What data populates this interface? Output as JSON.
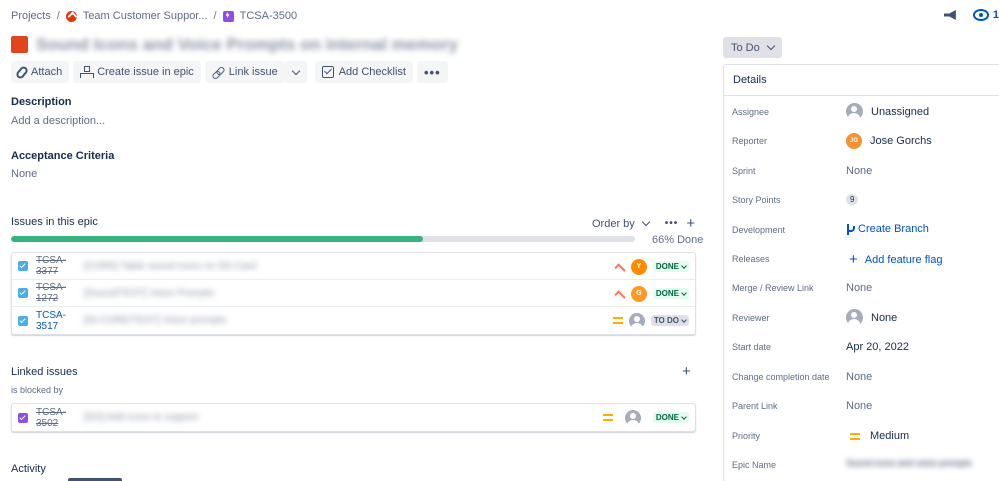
{
  "breadcrumb": {
    "projects": "Projects",
    "project": "Team Customer Suppor...",
    "epic_key": "TCSA-3500",
    "separator": "/"
  },
  "header": {
    "watch_count": "1",
    "title": "Sound Icons and Voice Prompts on internal memory"
  },
  "toolbar": {
    "attach": "Attach",
    "create_issue_in_epic": "Create issue in epic",
    "link_issue": "Link issue",
    "add_checklist": "Add Checklist",
    "more": "•••"
  },
  "description": {
    "label": "Description",
    "placeholder": "Add a description..."
  },
  "acceptance": {
    "label": "Acceptance Criteria",
    "value": "None"
  },
  "epic_issues": {
    "label": "Issues in this epic",
    "order_by": "Order by",
    "more": "•••",
    "add": "+",
    "progress_done_fraction": 0.66,
    "progress_label": "66% Done",
    "items": [
      {
        "key": "TCSA-3377",
        "summary": "[CORE] Table sound icons on SD Card",
        "priority": "high",
        "avatar": "Y",
        "status": "DONE",
        "resolved": true
      },
      {
        "key": "TCSA-1272",
        "summary": "[Sound/TEST] Voice Prompts",
        "priority": "high",
        "avatar": "G",
        "status": "DONE",
        "resolved": true
      },
      {
        "key": "TCSA-3517",
        "summary": "[NI-CORE/TEST] Voice prompts",
        "priority": "medium",
        "avatar": "",
        "status": "TO DO",
        "resolved": false
      }
    ]
  },
  "linked_issues": {
    "label": "Linked issues",
    "add": "+",
    "relation": "is blocked by",
    "items": [
      {
        "key": "TCSA-3502",
        "summary": "[DO] Add icons to support",
        "status": "DONE",
        "resolved": true
      }
    ]
  },
  "activity": {
    "label": "Activity"
  },
  "status_button": {
    "label": "To Do"
  },
  "details": {
    "heading": "Details",
    "assignee": {
      "label": "Assignee",
      "value": "Unassigned"
    },
    "reporter": {
      "label": "Reporter",
      "value": "Jose Gorchs",
      "initials": "JG"
    },
    "sprint": {
      "label": "Sprint",
      "value": "None"
    },
    "story_points": {
      "label": "Story Points",
      "value": "9"
    },
    "development": {
      "label": "Development",
      "value": "Create Branch"
    },
    "releases": {
      "label": "Releases",
      "value": "Add feature flag"
    },
    "merge_link": {
      "label": "Merge / Review Link",
      "value": "None"
    },
    "reviewer": {
      "label": "Reviewer",
      "value": "None"
    },
    "start_date": {
      "label": "Start date",
      "value": "Apr 20, 2022"
    },
    "change_completion": {
      "label": "Change completion date",
      "value": "None"
    },
    "parent_link": {
      "label": "Parent Link",
      "value": "None"
    },
    "priority": {
      "label": "Priority",
      "value": "Medium"
    },
    "epic_name": {
      "label": "Epic Name",
      "value": "Sound icons and voice prompts"
    }
  },
  "colors": {
    "accent": "#0052cc",
    "progress": "#36b37e",
    "epic": "#904ee2",
    "issue_type": "#e0451f"
  }
}
